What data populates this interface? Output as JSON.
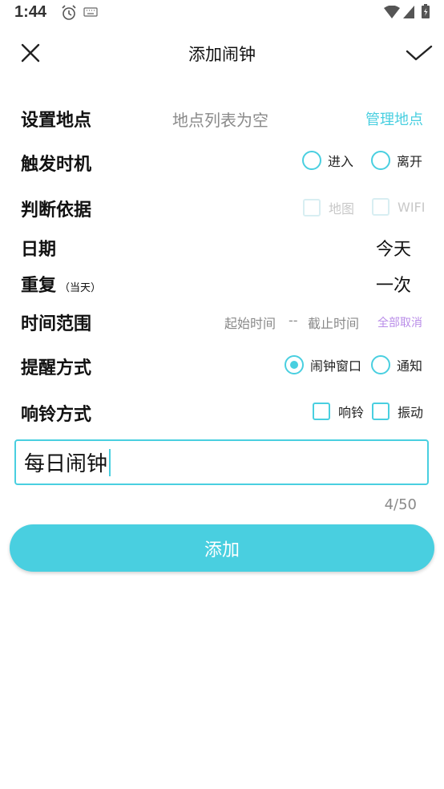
{
  "status_bar": {
    "time": "1:44",
    "icons": [
      "alarm-icon",
      "keyboard-icon",
      "wifi-icon",
      "signal-icon",
      "battery-icon"
    ]
  },
  "header": {
    "title": "添加闹钟",
    "close_icon": "close-icon",
    "confirm_icon": "check-icon"
  },
  "location": {
    "label": "设置地点",
    "value": "地点列表为空",
    "manage": "管理地点"
  },
  "trigger": {
    "label": "触发时机",
    "options": [
      "进入",
      "离开"
    ]
  },
  "basis": {
    "label": "判断依据",
    "options": [
      "地图",
      "WIFI"
    ]
  },
  "date": {
    "label": "日期",
    "value": "今天"
  },
  "repeat": {
    "label": "重复",
    "sub": "（当天）",
    "value": "一次"
  },
  "time_range": {
    "label": "时间范围",
    "start": "起始时间",
    "separator": "--",
    "end": "截止时间",
    "clear": "全部取消"
  },
  "reminder": {
    "label": "提醒方式",
    "options": [
      "闹钟窗口",
      "通知"
    ],
    "selected": "闹钟窗口"
  },
  "ring": {
    "label": "响铃方式",
    "options": [
      "响铃",
      "振动"
    ]
  },
  "name_input": {
    "value": "每日闹钟",
    "counter": "4/50"
  },
  "add_button": {
    "label": "添加"
  },
  "colors": {
    "accent": "#49cfe0",
    "purple": "#b98ce8",
    "muted": "#8a8a8a"
  }
}
